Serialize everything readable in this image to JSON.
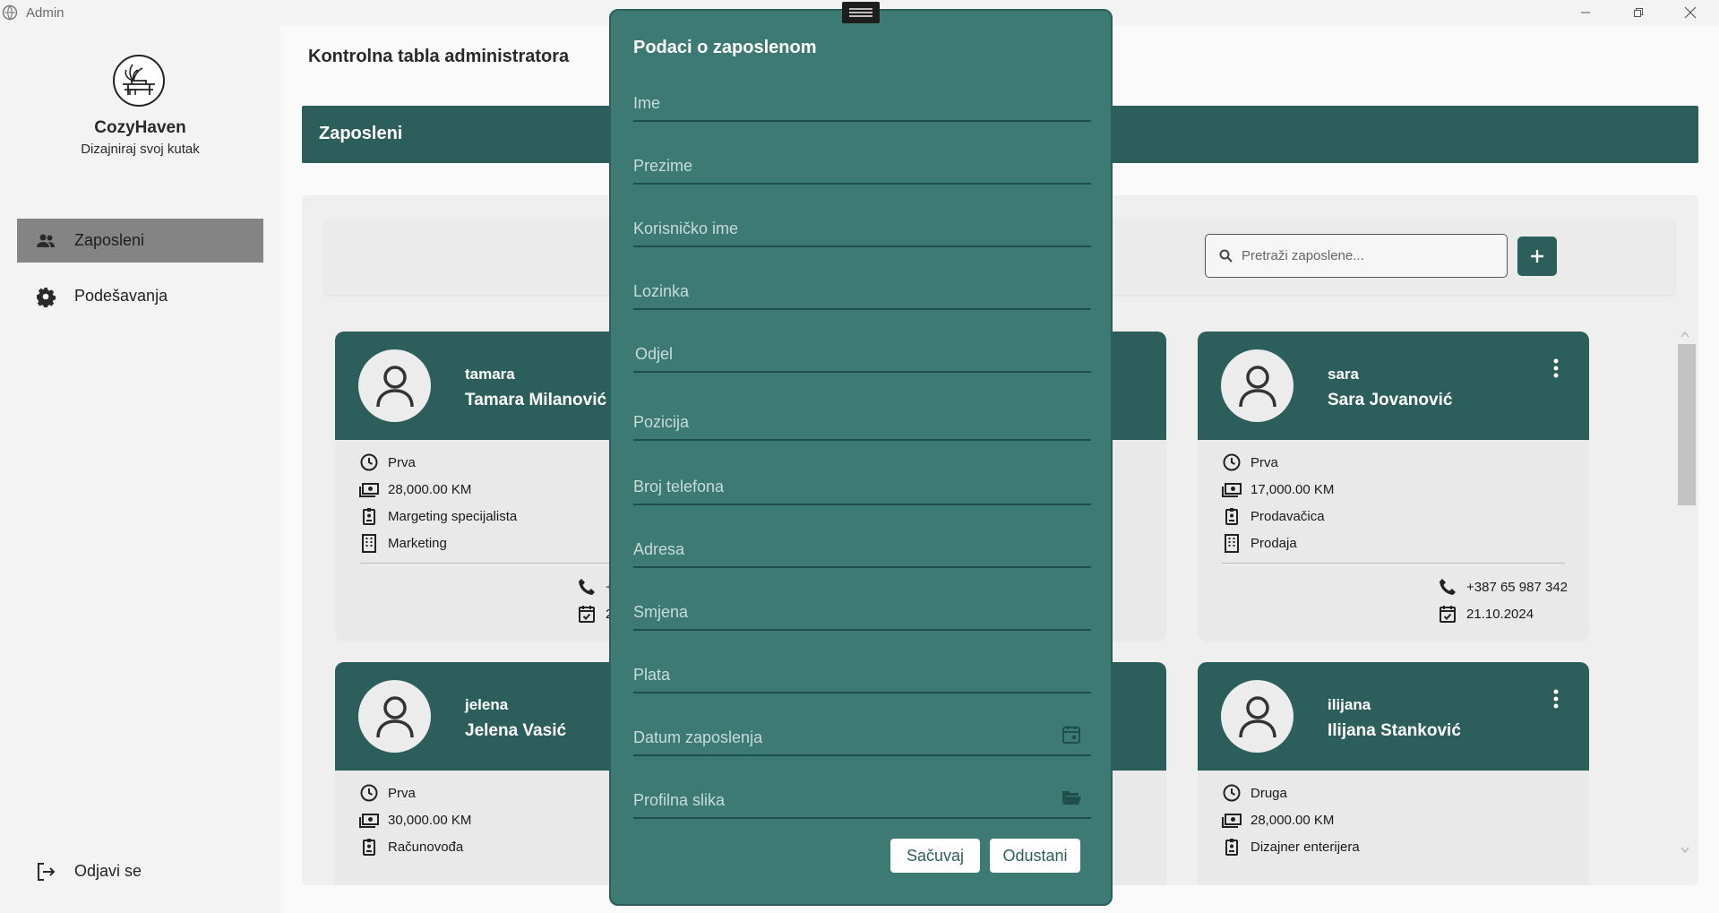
{
  "window": {
    "title": "Admin"
  },
  "sidebar": {
    "brand": "CozyHaven",
    "tagline": "Dizajniraj svoj kutak",
    "items": [
      {
        "label": "Zaposleni",
        "icon": "people-icon",
        "active": true
      },
      {
        "label": "Podešavanja",
        "icon": "gear-icon",
        "active": false
      }
    ],
    "logout": {
      "label": "Odjavi se",
      "icon": "logout-icon"
    }
  },
  "main": {
    "page_title": "Kontrolna tabla administratora",
    "section_title": "Zaposleni",
    "search": {
      "placeholder": "Pretraži zaposlene..."
    },
    "add_button": "+"
  },
  "employees": [
    {
      "username": "tamara",
      "name": "Tamara Milanović",
      "shift": "Prva",
      "salary": "28,000.00 KM",
      "position": "Margeting specijalista",
      "department": "Marketing",
      "phone": "+",
      "date": "2"
    },
    {
      "username": "sara",
      "name": "Sara Jovanović",
      "shift": "Prva",
      "salary": "17,000.00 KM",
      "position": "Prodavačica",
      "department": "Prodaja",
      "phone": "+387 65 987 342",
      "date": "21.10.2024"
    },
    {
      "username": "jelena",
      "name": "Jelena Vasić",
      "shift": "Prva",
      "salary": "30,000.00 KM",
      "position": "Računovođa"
    },
    {
      "username": "ilijana",
      "name": "Ilijana Stanković",
      "shift": "Druga",
      "salary": "28,000.00 KM",
      "position": "Dizajner enterijera"
    }
  ],
  "modal": {
    "title": "Podaci o zaposlenom",
    "fields": {
      "ime": "Ime",
      "prezime": "Prezime",
      "korisnicko_ime": "Korisničko ime",
      "lozinka": "Lozinka",
      "odjel": "Odjel",
      "pozicija": "Pozicija",
      "broj_telefona": "Broj telefona",
      "adresa": "Adresa",
      "smjena": "Smjena",
      "plata": "Plata",
      "datum_zaposlenja": "Datum zaposlenja",
      "profilna_slika": "Profilna slika"
    },
    "save_label": "Sačuvaj",
    "cancel_label": "Odustani"
  },
  "colors": {
    "primary": "#2c5f5b",
    "modal_bg": "#3d7a74",
    "active_nav": "#848484"
  }
}
